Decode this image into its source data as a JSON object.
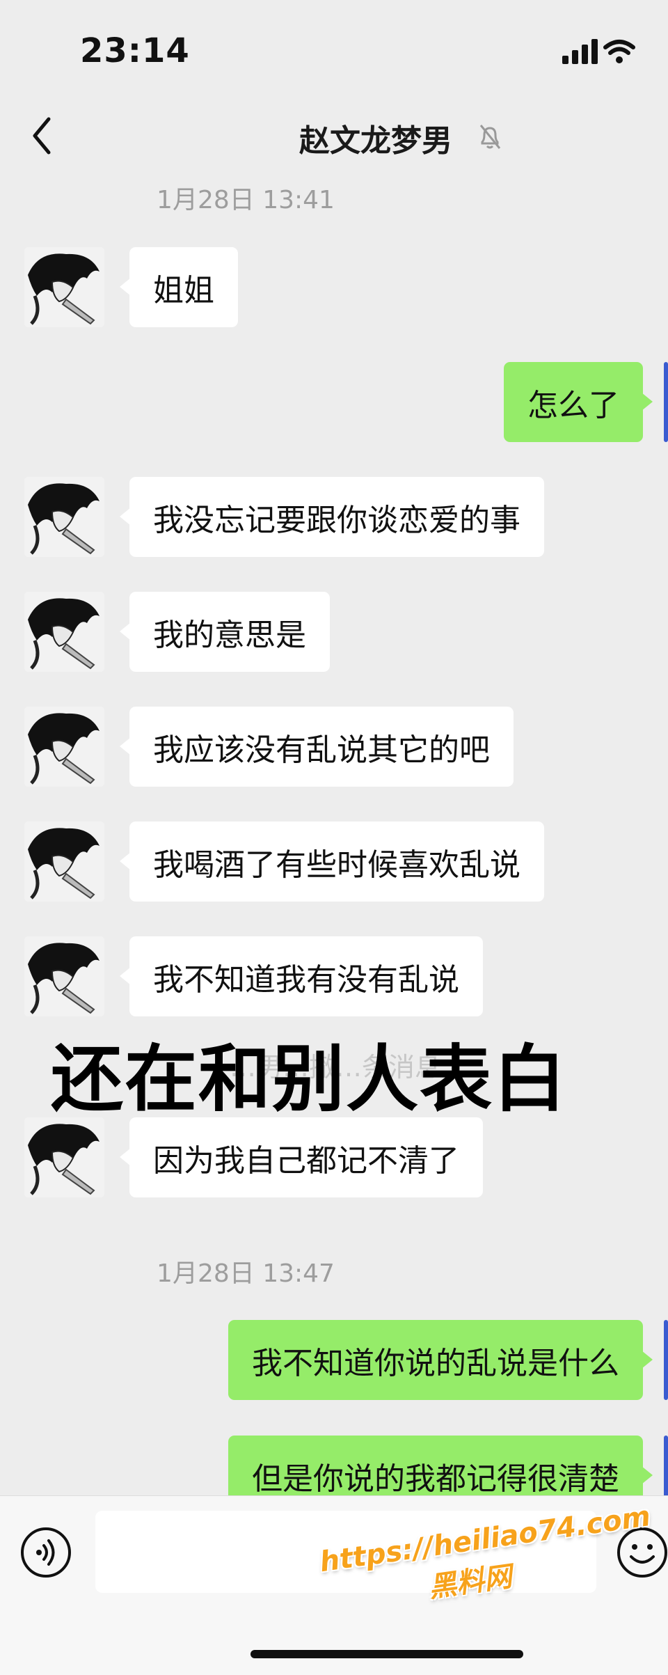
{
  "status_bar": {
    "time": "23:14"
  },
  "header": {
    "title": "赵文龙梦男",
    "back_icon": "chevron-left-icon",
    "mute_icon": "bell-muted-icon"
  },
  "chat": {
    "timestamps": [
      "1月28日 13:41",
      "1月28日 13:47"
    ],
    "messages": [
      {
        "side": "in",
        "text": "姐姐"
      },
      {
        "side": "out",
        "text": "怎么了"
      },
      {
        "side": "in",
        "text": "我没忘记要跟你谈恋爱的事"
      },
      {
        "side": "in",
        "text": "我的意思是"
      },
      {
        "side": "in",
        "text": "我应该没有乱说其它的吧"
      },
      {
        "side": "in",
        "text": "我喝酒了有些时候喜欢乱说"
      },
      {
        "side": "in",
        "text": "我不知道我有没有乱说"
      },
      {
        "side": "in",
        "text": "因为我自己都记不清了"
      },
      {
        "side": "out",
        "text": "我不知道你说的乱说是什么"
      },
      {
        "side": "out",
        "text": "但是你说的我都记得很清楚"
      }
    ],
    "overlay_caption": "还在和别人表白",
    "system_notice": "…男…撤…条消息"
  },
  "input_bar": {
    "voice_icon": "voice-icon",
    "emoji_icon": "emoji-icon"
  },
  "watermark": {
    "url": "https://heiliao74.com",
    "site": "黑料网"
  },
  "colors": {
    "background": "#ededed",
    "incoming": "#ffffff",
    "outgoing": "#95ec69",
    "watermark": "#f7a21b"
  }
}
